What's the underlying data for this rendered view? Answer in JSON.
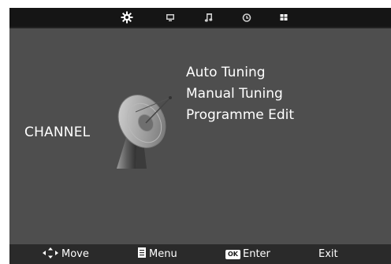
{
  "tabs": [
    {
      "name": "settings-gear-icon",
      "active": true
    },
    {
      "name": "monitor-icon",
      "active": false
    },
    {
      "name": "music-note-icon",
      "active": false
    },
    {
      "name": "clock-icon",
      "active": false
    },
    {
      "name": "lock-grid-icon",
      "active": false
    }
  ],
  "category": {
    "label": "CHANNEL",
    "icon": "satellite-dish-icon"
  },
  "menu": {
    "items": [
      {
        "label": "Auto Tuning"
      },
      {
        "label": "Manual Tuning"
      },
      {
        "label": "Programme Edit"
      }
    ]
  },
  "hints": {
    "move": {
      "label": "Move",
      "icon": "dpad-arrows-icon"
    },
    "menu": {
      "label": "Menu",
      "icon": "menu-list-icon"
    },
    "enter": {
      "label": "Enter",
      "badge": "OK"
    },
    "exit": {
      "label": "Exit",
      "icon": "exit-icon"
    }
  },
  "colors": {
    "background": "#4e4e4e",
    "topbar": "#151515",
    "active_tab": "#ffffff",
    "inactive_tab": "#cfcfcf",
    "text": "#ffffff"
  }
}
